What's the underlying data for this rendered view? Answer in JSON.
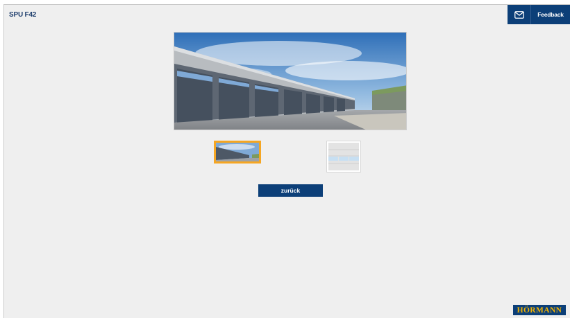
{
  "header": {
    "title": "SPU F42",
    "feedback_label": "Feedback",
    "mail_icon": "mail-icon"
  },
  "gallery": {
    "hero_image": "industrial-garage-doors-photo",
    "thumbnails": [
      {
        "name": "building-photo-thumbnail",
        "selected": true
      },
      {
        "name": "door-panel-thumbnail",
        "selected": false
      }
    ]
  },
  "actions": {
    "back_label": "zurück"
  },
  "brand": {
    "logo_text": "HÖRMANN"
  },
  "colors": {
    "brand_blue": "#0c3f78",
    "selection_orange": "#f5a623",
    "logo_yellow": "#f5b400",
    "background": "#efefef"
  }
}
